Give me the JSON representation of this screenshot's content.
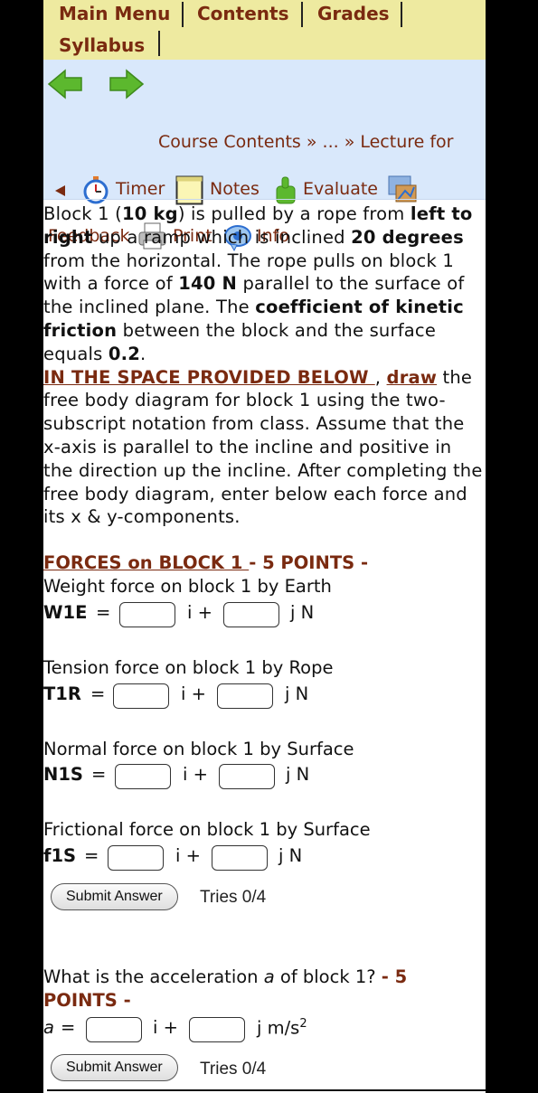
{
  "menu": {
    "items": [
      "Main Menu",
      "Contents",
      "Grades",
      "Syllabus"
    ]
  },
  "nav": {
    "breadcrumb": "Course Contents » ... » Lecture for",
    "timer": "Timer",
    "notes": "Notes",
    "evaluate": "Evaluate",
    "feedback": "Feedback",
    "print": "Print",
    "info": "Info"
  },
  "problem": {
    "p1_a": "Block 1 (",
    "mass": "10 kg",
    "p1_b": ") is pulled by a rope from ",
    "dir": "left to right",
    "p1_c": " up a ramp which is inclined ",
    "angle": "20 degrees",
    "p1_d": " from the horizontal. The rope pulls on block 1 with a force of ",
    "force": "140 N",
    "p1_e": " parallel to the surface of the inclined plane. The ",
    "coef": "coefficient of kinetic friction",
    "p1_f": " between the block and the surface equals ",
    "mu": "0.2",
    "p1_g": ".",
    "space": "IN THE SPACE PROVIDED BELOW ",
    "comma": ", ",
    "draw": "draw",
    "p2": " the free body diagram for block 1 using the two-subscript notation from class. Assume that the x-axis is parallel to the incline and positive in the direction up the incline. After completing the free body diagram, enter below each force and its x & y-components."
  },
  "forces": {
    "heading": "FORCES on BLOCK 1 ",
    "points": "- 5 POINTS -",
    "items": [
      {
        "desc": "Weight force on block 1 by Earth",
        "label": "W1E",
        "eq": "=",
        "i": "i +",
        "unit": "j N"
      },
      {
        "desc": "Tension force on block 1 by Rope",
        "label": "T1R",
        "eq": "=",
        "i": "i +",
        "unit": "j N"
      },
      {
        "desc": "Normal force on block 1 by Surface",
        "label": "N1S",
        "eq": "=",
        "i": "i +",
        "unit": "j N"
      },
      {
        "desc": "Frictional force on block 1 by Surface",
        "label": "f1S",
        "eq": "=",
        "i": "i +",
        "unit": "j N"
      }
    ],
    "submit": "Submit Answer",
    "tries": "Tries 0/4"
  },
  "accel": {
    "q_a": "What is the acceleration ",
    "q_var": "a",
    "q_b": " of block 1? ",
    "points": "- 5 POINTS -",
    "label": "a",
    "eq": "=",
    "i": "i +",
    "unit": "j m/s",
    "unit_exp": "2",
    "submit": "Submit Answer",
    "tries": "Tries 0/4"
  },
  "colors": {
    "menu_bg": "#eeeaa0",
    "nav_bg": "#d9e8fb",
    "link": "#7a2a10",
    "arrow_green": "#5cb82e"
  }
}
